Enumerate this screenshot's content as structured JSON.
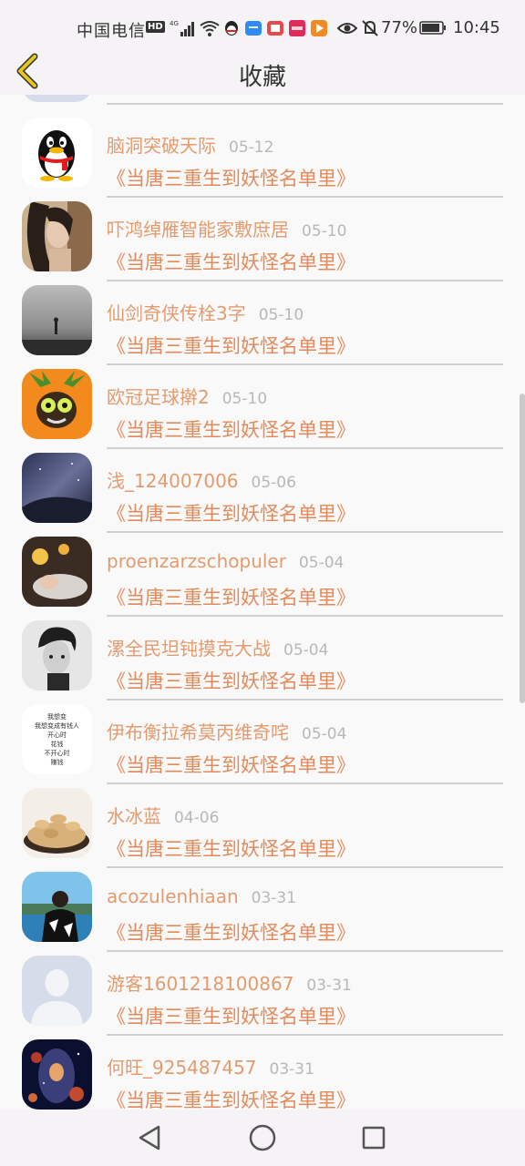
{
  "status_bar": {
    "carrier": "中国电信",
    "hd": "HD",
    "battery": "77%",
    "time": "10:45",
    "icons": [
      "signal-icon",
      "wifi-icon",
      "qq-icon",
      "message-icon",
      "book-icon",
      "app-icon",
      "play-icon",
      "eye-icon",
      "mute-bell-icon",
      "battery-icon"
    ]
  },
  "header": {
    "title": "收藏",
    "back_icon": "chevron-left-icon"
  },
  "list": {
    "items": [
      {
        "name": "脑洞突破天际",
        "date": "05-12",
        "book": "《当唐三重生到妖怪名单里》"
      },
      {
        "name": "吓鸿绰雁智能家敷庶居",
        "date": "05-10",
        "book": "《当唐三重生到妖怪名单里》"
      },
      {
        "name": "仙剑奇侠传栓3字",
        "date": "05-10",
        "book": "《当唐三重生到妖怪名单里》"
      },
      {
        "name": "欧冠足球擀2",
        "date": "05-10",
        "book": "《当唐三重生到妖怪名单里》"
      },
      {
        "name": "浅_124007006",
        "date": "05-06",
        "book": "《当唐三重生到妖怪名单里》"
      },
      {
        "name": "proenzarzschopuler",
        "date": "05-04",
        "book": "《当唐三重生到妖怪名单里》"
      },
      {
        "name": "漯全民坦钝摸克大战",
        "date": "05-04",
        "book": "《当唐三重生到妖怪名单里》"
      },
      {
        "name": "伊布衡拉希莫丙维奇咤",
        "date": "05-04",
        "book": "《当唐三重生到妖怪名单里》"
      },
      {
        "name": "水冰蓝",
        "date": "04-06",
        "book": "《当唐三重生到妖怪名单里》"
      },
      {
        "name": "acozulenhiaan",
        "date": "03-31",
        "book": "《当唐三重生到妖怪名单里》"
      },
      {
        "name": "游客1601218100867",
        "date": "03-31",
        "book": "《当唐三重生到妖怪名单里》"
      },
      {
        "name": "何旺_925487457",
        "date": "03-31",
        "book": "《当唐三重生到妖怪名单里》"
      }
    ],
    "avatar_text_lines": [
      "我想变",
      "我想变成有钱人",
      "开心时",
      "花钱",
      "不开心时",
      "赚钱"
    ]
  },
  "colors": {
    "name": "#e39b6e",
    "book": "#e38a5a",
    "date": "#b8b8b8",
    "back_icon": "#e7c51c"
  },
  "nav_bar": {
    "icons": [
      "back-triangle-icon",
      "home-circle-icon",
      "recents-square-icon"
    ]
  }
}
